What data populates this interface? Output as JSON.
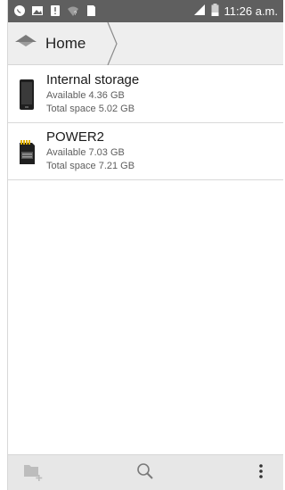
{
  "status_bar": {
    "time": "11:26 a.m."
  },
  "header": {
    "breadcrumb_home": "Home"
  },
  "storage_items": [
    {
      "title": "Internal storage",
      "available": "Available 4.36 GB",
      "total": "Total space 5.02 GB",
      "icon": "phone-icon"
    },
    {
      "title": "POWER2",
      "available": "Available 7.03 GB",
      "total": "Total space 7.21 GB",
      "icon": "sd-card-icon"
    }
  ],
  "bottom_bar": {
    "icons": [
      "new-folder-icon",
      "search-icon",
      "more-options-icon"
    ]
  },
  "colors": {
    "status_bar": "#5f5f5f",
    "header_bg": "#eeeeee",
    "bottom_bar_bg": "#e7e7e7"
  }
}
